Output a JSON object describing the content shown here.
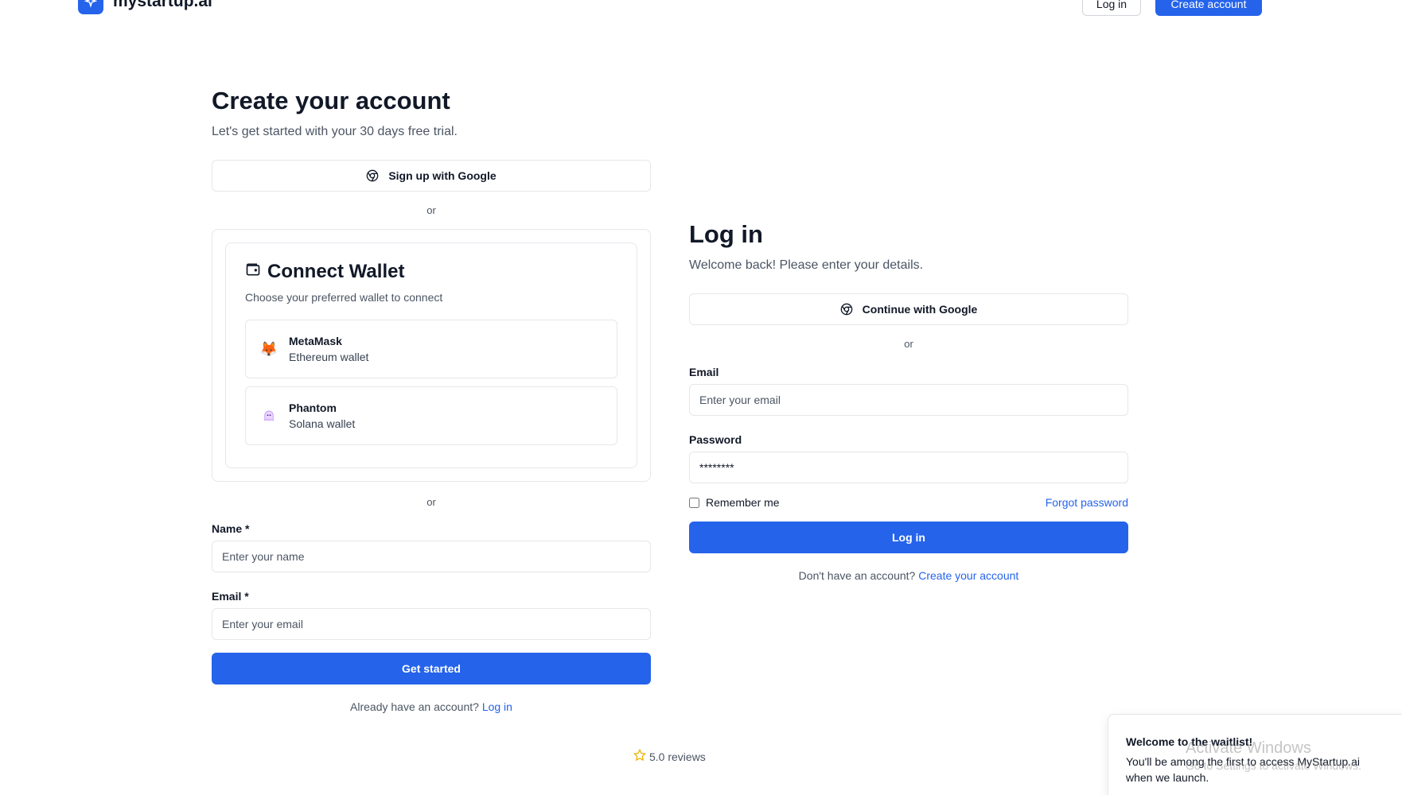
{
  "header": {
    "brand": "mystartup.ai",
    "login_label": "Log in",
    "create_label": "Create account"
  },
  "signup": {
    "title": "Create your account",
    "subtitle": "Let's get started with your 30 days free trial.",
    "google_label": "Sign up with Google",
    "or1": "or",
    "wallet": {
      "title": "Connect Wallet",
      "subtitle": "Choose your preferred wallet to connect",
      "items": [
        {
          "name": "MetaMask",
          "desc": "Ethereum wallet",
          "icon": "fox-icon"
        },
        {
          "name": "Phantom",
          "desc": "Solana wallet",
          "icon": "ghost-icon"
        }
      ]
    },
    "or2": "or",
    "name_label": "Name *",
    "name_placeholder": "Enter your name",
    "email_label": "Email *",
    "email_placeholder": "Enter your email",
    "submit_label": "Get started",
    "footer_text": "Already have an account?",
    "footer_link": "Log in"
  },
  "login": {
    "title": "Log in",
    "subtitle": "Welcome back! Please enter your details.",
    "google_label": "Continue with Google",
    "or": "or",
    "email_label": "Email",
    "email_placeholder": "Enter your email",
    "password_label": "Password",
    "password_value": "********",
    "remember_label": "Remember me",
    "forgot_label": "Forgot password",
    "submit_label": "Log in",
    "footer_text": "Don't have an account?",
    "footer_link": "Create your account"
  },
  "reviews": {
    "text": "5.0 reviews"
  },
  "toast": {
    "title": "Welcome to the waitlist!",
    "body": "You'll be among the first to access MyStartup.ai when we launch."
  },
  "watermark": {
    "title": "Activate Windows",
    "subtitle": "Go to Settings to activate Windows."
  },
  "colors": {
    "primary": "#2563eb",
    "border": "#e5e7eb",
    "text": "#111827",
    "muted": "#4b5563"
  }
}
